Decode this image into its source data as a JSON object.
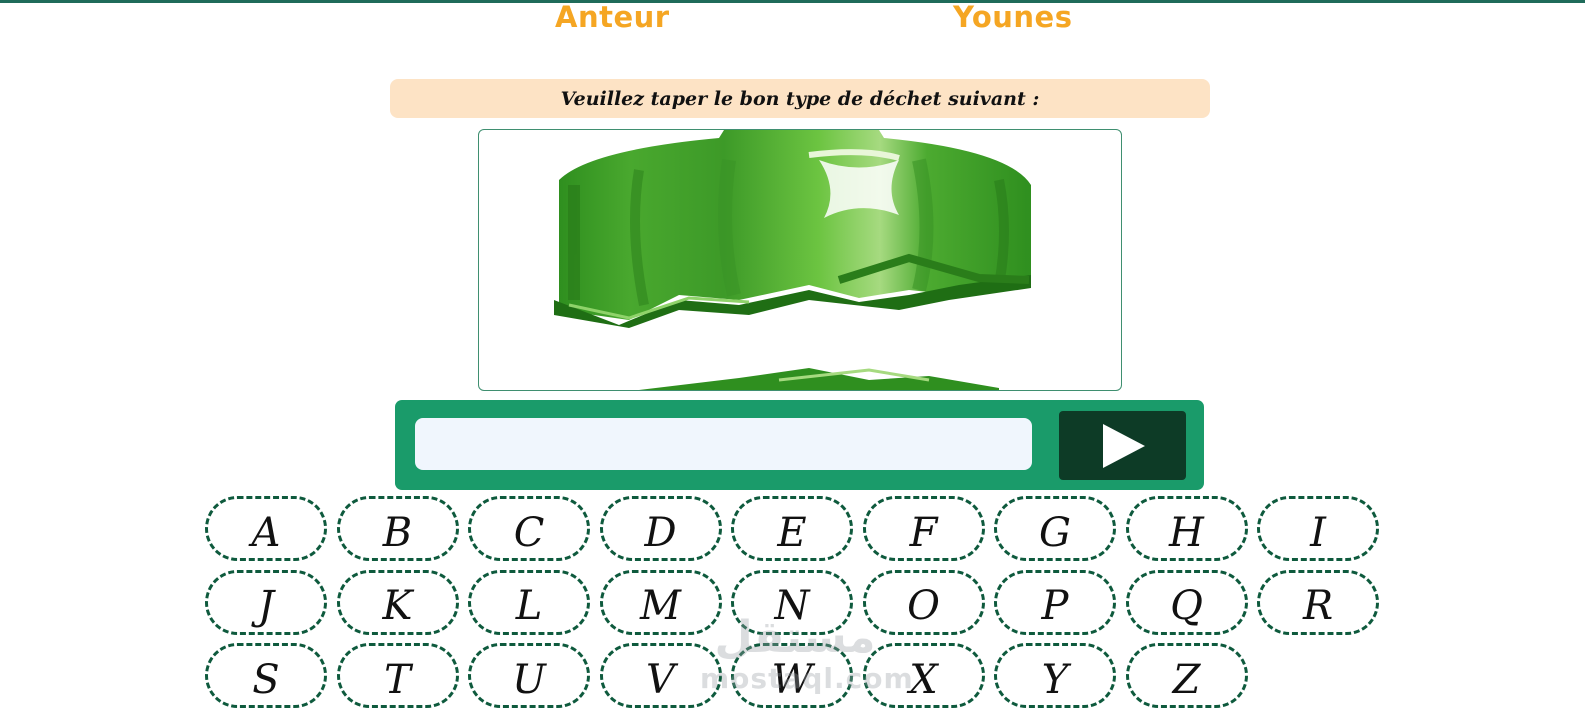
{
  "header": {
    "author_label": "Anteur",
    "author_name": "Younes"
  },
  "prompt": {
    "text": "Veuillez taper le bon type de déchet suivant :"
  },
  "image": {
    "description_icon": "green-bottle-cap-image"
  },
  "answer": {
    "value": "",
    "placeholder": ""
  },
  "submit": {
    "icon": "play-icon"
  },
  "keyboard": {
    "keys": [
      "A",
      "B",
      "C",
      "D",
      "E",
      "F",
      "G",
      "H",
      "I",
      "J",
      "K",
      "L",
      "M",
      "N",
      "O",
      "P",
      "Q",
      "R",
      "S",
      "T",
      "U",
      "V",
      "W",
      "X",
      "Y",
      "Z"
    ]
  },
  "watermark": {
    "arabic": "مستقل",
    "latin": "mostaql.com"
  },
  "colors": {
    "accent_orange": "#f5a623",
    "prompt_bg": "#fde3c5",
    "input_bar": "#1a9b6a",
    "submit_bg": "#0d3b26",
    "key_border": "#0e5a3d"
  }
}
